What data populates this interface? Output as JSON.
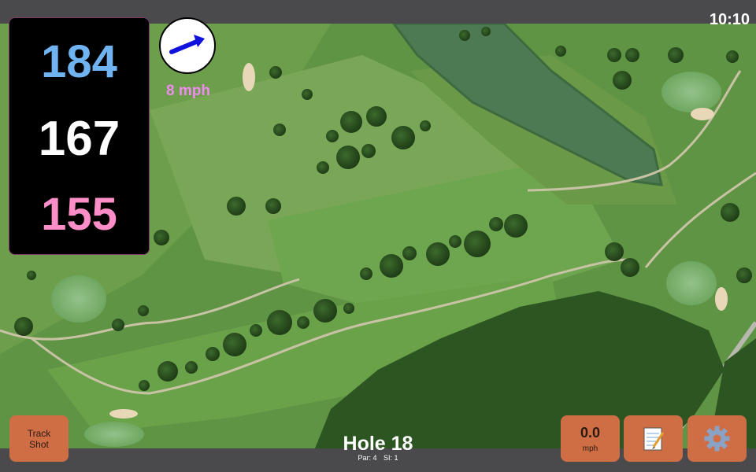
{
  "status_bar": {
    "time": "10:10"
  },
  "distances": {
    "back": "184",
    "middle": "167",
    "front": "155"
  },
  "wind": {
    "speed_label": "8 mph",
    "direction_icon": "arrow-icon"
  },
  "hole": {
    "title": "Hole 18",
    "par_label": "Par: 4",
    "si_label": "SI: 1"
  },
  "buttons": {
    "track_shot": "Track\nShot",
    "speed_value": "0.0",
    "speed_unit": "mph",
    "notes_icon": "notepad-icon",
    "settings_icon": "gear-icon"
  },
  "colors": {
    "back": "#6fb3f0",
    "middle": "#ffffff",
    "front": "#ff8ec8",
    "wind_label": "#f08cf0",
    "button": "#cf6e45",
    "bar": "#4a4a4c"
  }
}
